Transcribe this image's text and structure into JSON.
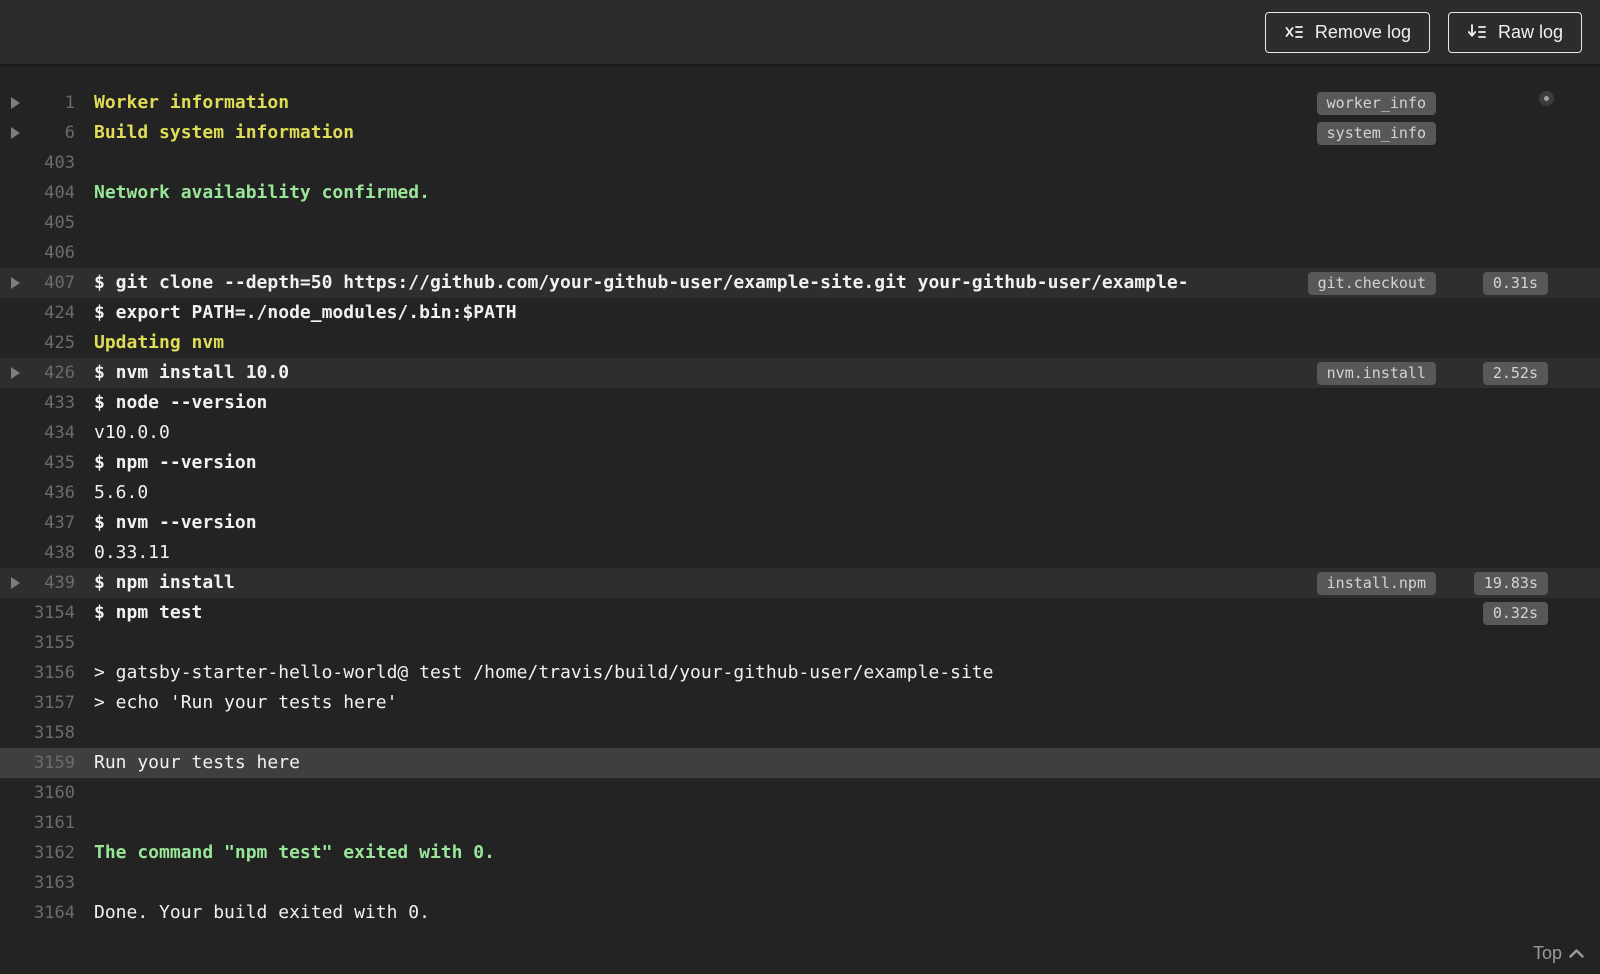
{
  "colors": {
    "page-bg": "#232323",
    "header-bg": "#2c2c2c",
    "cmd-row-bg": "#2e2e2e",
    "highlight-row-bg": "#3f3f3f",
    "text": "#f1f1f1",
    "line-num": "#6c6c6c",
    "yellow": "#dfdc55",
    "green": "#99e699",
    "badge-bg": "#585858",
    "badge-text": "#d4d4d4",
    "muted": "#9a9a9a"
  },
  "header": {
    "buttons": [
      {
        "label": "Remove log",
        "icon": "remove-log-icon"
      },
      {
        "label": "Raw log",
        "icon": "raw-log-icon"
      }
    ]
  },
  "footer": {
    "top_label": "Top",
    "top_icon": "caret-up-icon"
  },
  "log": {
    "lines": [
      {
        "num": "1",
        "text": "Worker information",
        "color": "yellow",
        "fold": true,
        "badge": "worker_info"
      },
      {
        "num": "6",
        "text": "Build system information",
        "color": "yellow",
        "fold": true,
        "badge": "system_info"
      },
      {
        "num": "403",
        "text": ""
      },
      {
        "num": "404",
        "text": "Network availability confirmed.",
        "color": "green"
      },
      {
        "num": "405",
        "text": ""
      },
      {
        "num": "406",
        "text": ""
      },
      {
        "num": "407",
        "text": "$ git clone --depth=50 https://github.com/your-github-user/example-site.git your-github-user/example-",
        "bold": true,
        "fold": true,
        "badge": "git.checkout",
        "duration": "0.31s",
        "row": "cmdrow"
      },
      {
        "num": "424",
        "text": "$ export PATH=./node_modules/.bin:$PATH",
        "bold": true
      },
      {
        "num": "425",
        "text": "Updating nvm",
        "color": "yellow"
      },
      {
        "num": "426",
        "text": "$ nvm install 10.0",
        "bold": true,
        "fold": true,
        "badge": "nvm.install",
        "duration": "2.52s",
        "row": "cmdrow"
      },
      {
        "num": "433",
        "text": "$ node --version",
        "bold": true
      },
      {
        "num": "434",
        "text": "v10.0.0"
      },
      {
        "num": "435",
        "text": "$ npm --version",
        "bold": true
      },
      {
        "num": "436",
        "text": "5.6.0"
      },
      {
        "num": "437",
        "text": "$ nvm --version",
        "bold": true
      },
      {
        "num": "438",
        "text": "0.33.11"
      },
      {
        "num": "439",
        "text": "$ npm install",
        "bold": true,
        "fold": true,
        "badge": "install.npm",
        "duration": "19.83s",
        "row": "cmdrow"
      },
      {
        "num": "3154",
        "text": "$ npm test",
        "bold": true,
        "duration": "0.32s"
      },
      {
        "num": "3155",
        "text": ""
      },
      {
        "num": "3156",
        "text": "> gatsby-starter-hello-world@ test /home/travis/build/your-github-user/example-site"
      },
      {
        "num": "3157",
        "text": "> echo 'Run your tests here'"
      },
      {
        "num": "3158",
        "text": ""
      },
      {
        "num": "3159",
        "text": "Run your tests here",
        "row": "highlight"
      },
      {
        "num": "3160",
        "text": ""
      },
      {
        "num": "3161",
        "text": ""
      },
      {
        "num": "3162",
        "text": "The command \"npm test\" exited with 0.",
        "color": "green"
      },
      {
        "num": "3163",
        "text": ""
      },
      {
        "num": "3164",
        "text": "Done. Your build exited with 0."
      }
    ]
  }
}
